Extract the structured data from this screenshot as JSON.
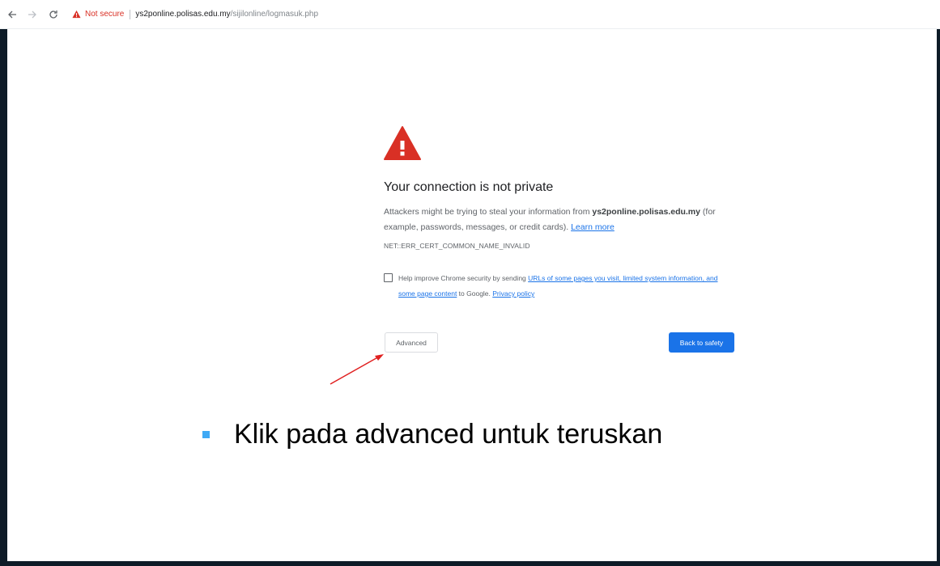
{
  "browser": {
    "security_label": "Not secure",
    "url_host": "ys2ponline.polisas.edu.my",
    "url_path": "/sijilonline/logmasuk.php"
  },
  "interstitial": {
    "heading": "Your connection is not private",
    "explanation_prefix": "Attackers might be trying to steal your information from ",
    "host_bold": "ys2ponline.polisas.edu.my",
    "explanation_suffix": " (for example, passwords, messages, or credit cards). ",
    "learn_more": "Learn more",
    "error_code": "NET::ERR_CERT_COMMON_NAME_INVALID",
    "opt_in_prefix": "Help improve Chrome security by sending ",
    "opt_in_link": "URLs of some pages you visit, limited system information, and some page content",
    "opt_in_middle": " to Google. ",
    "privacy_link": "Privacy policy",
    "advanced_button": "Advanced",
    "back_button": "Back to safety"
  },
  "slide": {
    "bullet_text": "Klik pada advanced untuk teruskan"
  },
  "colors": {
    "warning_red": "#d93025",
    "primary_blue": "#1a73e8",
    "bullet_blue": "#3fa9f5",
    "arrow_red": "#e02020",
    "frame_dark": "#0d1b27"
  },
  "icons": [
    "back-arrow-icon",
    "forward-arrow-icon",
    "reload-icon",
    "warning-icon"
  ]
}
